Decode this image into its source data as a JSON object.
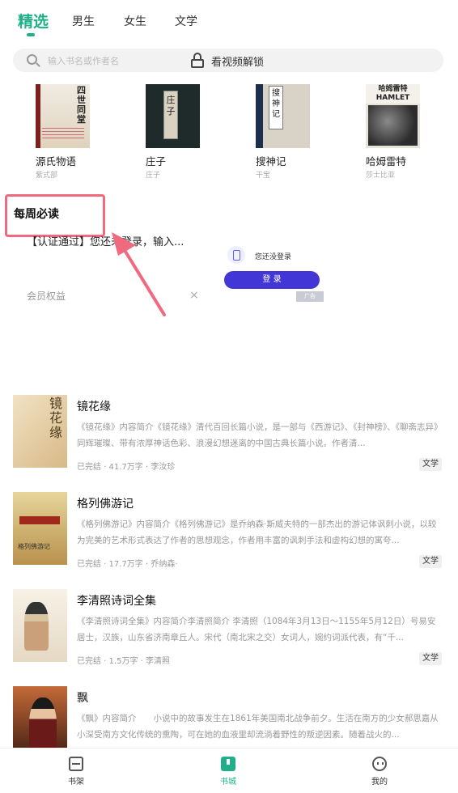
{
  "tabs": [
    {
      "label": "精选",
      "active": true
    },
    {
      "label": "男生",
      "active": false
    },
    {
      "label": "女生",
      "active": false
    },
    {
      "label": "文学",
      "active": false
    }
  ],
  "search": {
    "placeholder": "输入书名或作者名",
    "unlock_label": "看视频解锁"
  },
  "recommended": [
    {
      "title": "源氏物语",
      "author": "紫式部",
      "cover_text": "四世同堂"
    },
    {
      "title": "庄子",
      "author": "庄子",
      "cover_text": "庄子"
    },
    {
      "title": "搜神记",
      "author": "干宝",
      "cover_text": "搜神记"
    },
    {
      "title": "哈姆雷特",
      "author": "莎士比亚",
      "cover_text": "哈姆雷特 HAMLET"
    }
  ],
  "weekly": {
    "title": "每周必读"
  },
  "ad": {
    "notice": "【认证通过】您还未登录，输入...",
    "login_tip": "您还没登录",
    "login_button": "登 录",
    "ad_tag": "广告",
    "member_rights": "会员权益",
    "close": "×"
  },
  "books": [
    {
      "title": "镜花缘",
      "cover_text": "镜花缘",
      "description": "《镜花缘》内容简介《镜花缘》清代百回长篇小说，是一部与《西游记》、《封神榜》、《聊斋志异》同辉璀璨、带有浓厚神话色彩、浪漫幻想迷离的中国古典长篇小说。作者清...",
      "meta": "已完结 · 41.7万字 · 李汝珍",
      "tag": "文学"
    },
    {
      "title": "格列佛游记",
      "cover_text": "格列佛游记",
      "description": "《格列佛游记》内容简介《格列佛游记》是乔纳森·斯威夫特的一部杰出的游记体讽刺小说，以较为完美的艺术形式表达了作者的思想观念，作者用丰富的讽刺手法和虚构幻想的寓夸...",
      "meta": "已完结 · 17.7万字 · 乔纳森·",
      "tag": "文学"
    },
    {
      "title": "李清照诗词全集",
      "cover_text": "",
      "description": "《李清照诗词全集》内容简介李清照简介 李清照（1084年3月13日～1155年5月12日）号易安居士，汉族，山东省济南章丘人。宋代（南北宋之交）女词人，婉约词派代表，有“千...",
      "meta": "已完结 · 1.5万字 · 李清照",
      "tag": "文学"
    },
    {
      "title": "飘",
      "cover_text": "",
      "description": "《飘》内容简介　　小说中的故事发生在1861年美国南北战争前夕。生活在南方的少女郝思嘉从小深受南方文化传统的熏陶，可在她的血液里却流淌着野性的叛逆因素。随着战火的...",
      "meta": "",
      "tag": ""
    }
  ],
  "bottom_nav": [
    {
      "label": "书架",
      "icon": "shelf-icon",
      "active": false
    },
    {
      "label": "书城",
      "icon": "store-icon",
      "active": true
    },
    {
      "label": "我的",
      "icon": "me-icon",
      "active": false
    }
  ],
  "colors": {
    "accent": "#1fb08a",
    "highlight": "#f06a7f",
    "login_button": "#4336d6"
  }
}
